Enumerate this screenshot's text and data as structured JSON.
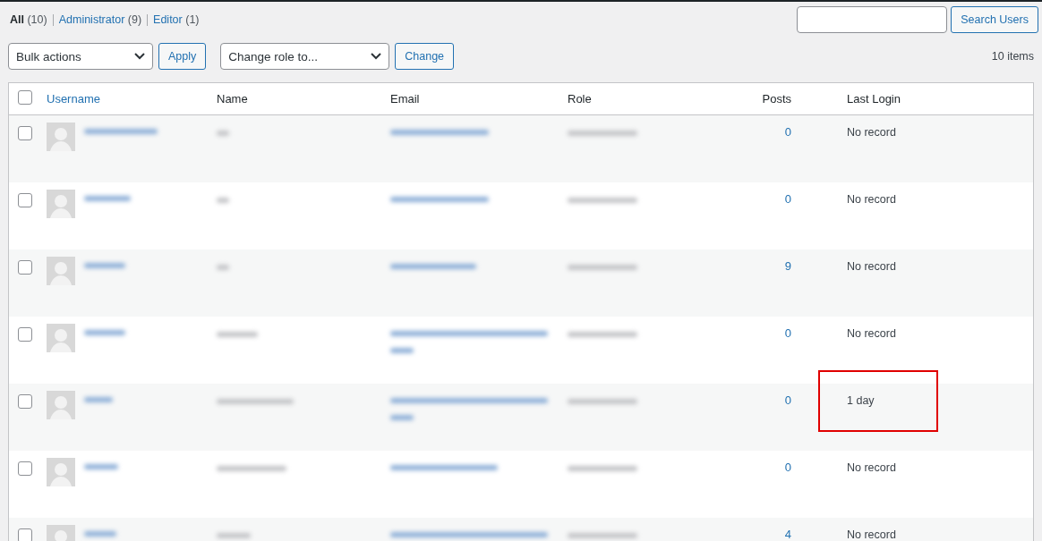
{
  "filters": [
    {
      "label": "All",
      "count": "(10)",
      "selected": true
    },
    {
      "label": "Administrator",
      "count": "(9)",
      "selected": false
    },
    {
      "label": "Editor",
      "count": "(1)",
      "selected": false
    }
  ],
  "search": {
    "button": "Search Users"
  },
  "bulk": {
    "select": "Bulk actions",
    "button": "Apply"
  },
  "role_change": {
    "select": "Change role to...",
    "button": "Change"
  },
  "item_count": "10 items",
  "table": {
    "select_all_checked": false,
    "columns": [
      {
        "label": "Username",
        "sortable": true
      },
      {
        "label": "Name",
        "sortable": false
      },
      {
        "label": "Email",
        "sortable": false
      },
      {
        "label": "Role",
        "sortable": false
      },
      {
        "label": "Posts",
        "sortable": false
      },
      {
        "label": "Last Login",
        "sortable": false
      }
    ],
    "rows": [
      {
        "checked": false,
        "posts": "0",
        "last_login": "No record",
        "highlighted": false
      },
      {
        "checked": false,
        "posts": "0",
        "last_login": "No record",
        "highlighted": false
      },
      {
        "checked": false,
        "posts": "9",
        "last_login": "No record",
        "highlighted": false
      },
      {
        "checked": false,
        "posts": "0",
        "last_login": "No record",
        "highlighted": false
      },
      {
        "checked": false,
        "posts": "0",
        "last_login": "1 day",
        "highlighted": true
      },
      {
        "checked": false,
        "posts": "0",
        "last_login": "No record",
        "highlighted": false
      },
      {
        "checked": false,
        "posts": "4",
        "last_login": "No record",
        "highlighted": false
      }
    ]
  }
}
